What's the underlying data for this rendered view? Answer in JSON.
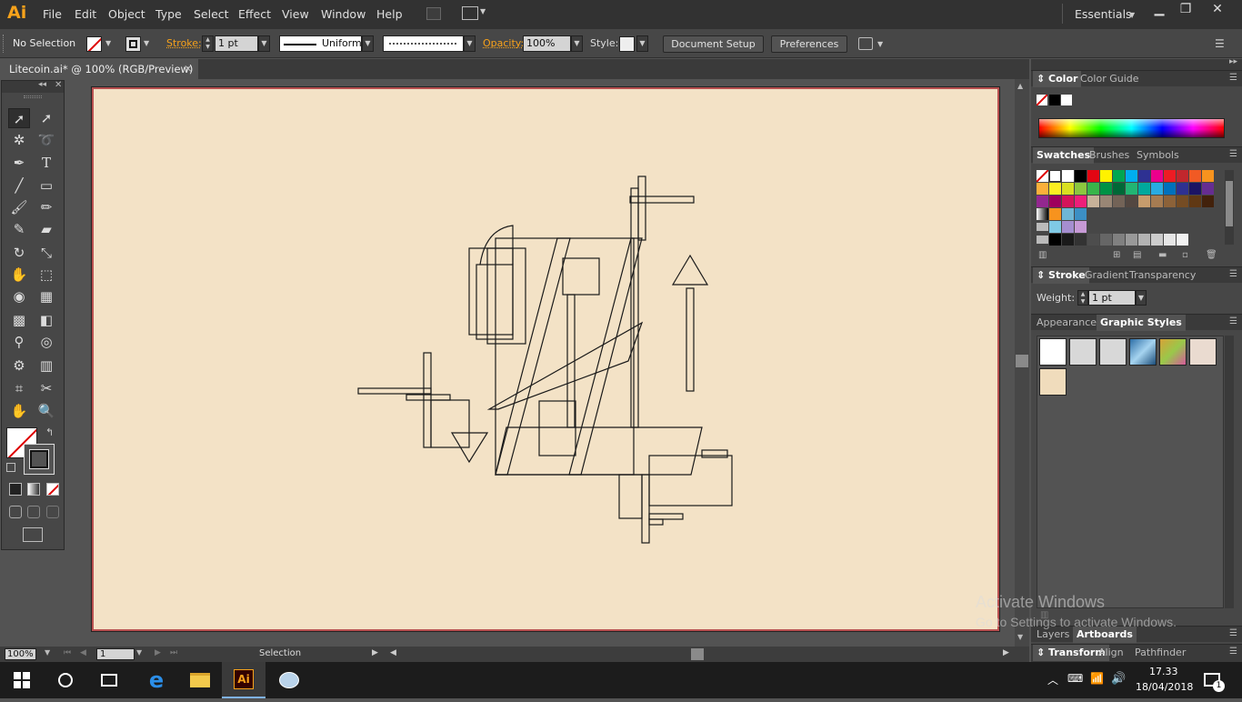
{
  "app": {
    "logo": "Ai",
    "menu": [
      "File",
      "Edit",
      "Object",
      "Type",
      "Select",
      "Effect",
      "View",
      "Window",
      "Help"
    ],
    "workspace": "Essentials"
  },
  "control": {
    "selection": "No Selection",
    "stroke_label": "Stroke:",
    "stroke_weight": "1 pt",
    "profile": "Uniform",
    "opacity_label": "Opacity:",
    "opacity_value": "100%",
    "style_label": "Style:",
    "document_setup": "Document Setup",
    "preferences": "Preferences"
  },
  "document": {
    "tab_title": "Litecoin.ai* @ 100% (RGB/Preview)",
    "close": "×"
  },
  "status": {
    "zoom": "100%",
    "artboard_num": "1",
    "tool": "Selection"
  },
  "panels": {
    "color_tabs": [
      "Color",
      "Color Guide"
    ],
    "swatch_tabs": [
      "Swatches",
      "Brushes",
      "Symbols"
    ],
    "stroke_tabs": [
      "Stroke",
      "Gradient",
      "Transparency"
    ],
    "weight_label": "Weight:",
    "weight_value": "1 pt",
    "appearance_tabs": [
      "Appearance",
      "Graphic Styles"
    ],
    "layers_tabs": [
      "Layers",
      "Artboards"
    ],
    "transform_tabs": [
      "Transform",
      "Align",
      "Pathfinder"
    ]
  },
  "watermark": {
    "line1": "Activate Windows",
    "line2": "Go to Settings to activate Windows."
  },
  "taskbar": {
    "time": "17.33",
    "date": "18/04/2018",
    "notif_count": "1",
    "ai_label": "Ai"
  },
  "colors": {
    "accent_orange": "#f7a21b",
    "artboard": "#f3e2c6",
    "artboard_border": "#b85050"
  }
}
